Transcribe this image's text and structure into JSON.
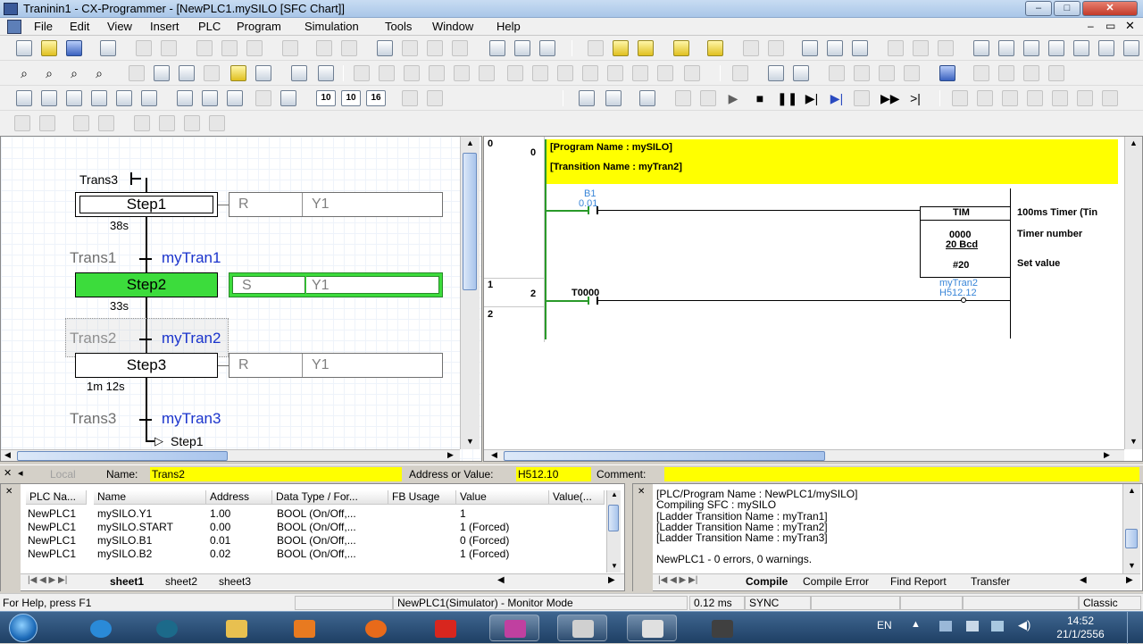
{
  "window": {
    "title": "Traninin1 - CX-Programmer - [NewPLC1.mySILO [SFC Chart]]"
  },
  "menu": [
    "File",
    "Edit",
    "View",
    "Insert",
    "PLC",
    "Program",
    "Simulation",
    "Tools",
    "Window",
    "Help"
  ],
  "toolbar": {
    "num1": "10",
    "num2": "10",
    "num3": "16"
  },
  "sfc": {
    "trans_top": "Trans3",
    "steps": [
      {
        "label": "Step1",
        "time": "38s",
        "qualifier": "R",
        "var": "Y1"
      },
      {
        "label": "Step2",
        "time": "33s",
        "qualifier": "S",
        "var": "Y1"
      },
      {
        "label": "Step3",
        "time": "1m 12s",
        "qualifier": "R",
        "var": "Y1"
      }
    ],
    "transitions": [
      {
        "label": "Trans1",
        "name": "myTran1"
      },
      {
        "label": "Trans2",
        "name": "myTran2"
      },
      {
        "label": "Trans3",
        "name": "myTran3"
      }
    ],
    "next_step": "Step1"
  },
  "ladder": {
    "rung0": "0",
    "rung1": "1",
    "rung2": "2",
    "step0": "0",
    "step2": "2",
    "program_name": "[Program Name : mySILO]",
    "transition_name": "[Transition Name : myTran2]",
    "contact1_name": "B1",
    "contact1_addr": "0.01",
    "contact2_name": "T0000",
    "tim": "TIM",
    "tim_num": "0000",
    "tim_bcd": "20 Bcd",
    "tim_set": "#20",
    "comment1": "100ms Timer (Tin",
    "comment2": "Timer number",
    "comment3": "Set value",
    "out_name": "myTran2",
    "out_addr": "H512.12"
  },
  "namebar": {
    "local": "Local",
    "name_label": "Name:",
    "name_value": "Trans2",
    "addr_label": "Address or Value:",
    "addr_value": "H512.10",
    "comment_label": "Comment:"
  },
  "watch": {
    "headers": [
      "PLC Na...",
      "Name",
      "Address",
      "Data Type / For...",
      "FB Usage",
      "Value",
      "Value(..."
    ],
    "rows": [
      [
        "NewPLC1",
        "mySILO.Y1",
        "1.00",
        "BOOL (On/Off,...",
        "",
        "1"
      ],
      [
        "NewPLC1",
        "mySILO.START",
        "0.00",
        "BOOL (On/Off,...",
        "",
        "1 (Forced)"
      ],
      [
        "NewPLC1",
        "mySILO.B1",
        "0.01",
        "BOOL (On/Off,...",
        "",
        "0 (Forced)"
      ],
      [
        "NewPLC1",
        "mySILO.B2",
        "0.02",
        "BOOL (On/Off,...",
        "",
        "1 (Forced)"
      ]
    ],
    "tabs": [
      "sheet1",
      "sheet2",
      "sheet3"
    ]
  },
  "output": {
    "lines": [
      "[PLC/Program Name : NewPLC1/mySILO]",
      "Compiling SFC : mySILO",
      "[Ladder Transition Name : myTran1]",
      "[Ladder Transition Name : myTran2]",
      "[Ladder Transition Name : myTran3]",
      "",
      "NewPLC1 - 0 errors, 0 warnings."
    ],
    "tabs": [
      "Compile",
      "Compile Error",
      "Find Report",
      "Transfer"
    ]
  },
  "status": {
    "help": "For Help, press F1",
    "mode": "NewPLC1(Simulator) - Monitor Mode",
    "cycle": "0.12 ms",
    "sync": "SYNC",
    "theme": "Classic"
  },
  "taskbar": {
    "lang": "EN",
    "time": "14:52",
    "date": "21/1/2556"
  }
}
